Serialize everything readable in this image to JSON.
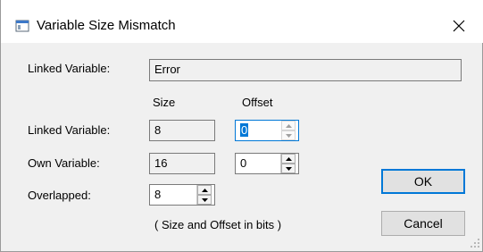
{
  "window": {
    "title": "Variable Size Mismatch",
    "close_label": "×"
  },
  "linked_variable": {
    "label": "Linked Variable:",
    "value": "Error"
  },
  "columns": {
    "size": "Size",
    "offset": "Offset"
  },
  "rows": {
    "linked": {
      "label": "Linked Variable:",
      "size": "8",
      "offset": "0"
    },
    "own": {
      "label": "Own Variable:",
      "size": "16",
      "offset": "0"
    },
    "overlapped": {
      "label": "Overlapped:",
      "size": "8"
    }
  },
  "note": "( Size and Offset in bits )",
  "buttons": {
    "ok": "OK",
    "cancel": "Cancel"
  },
  "colors": {
    "accent": "#0078d7",
    "dialog_bg": "#f0f0f0"
  }
}
